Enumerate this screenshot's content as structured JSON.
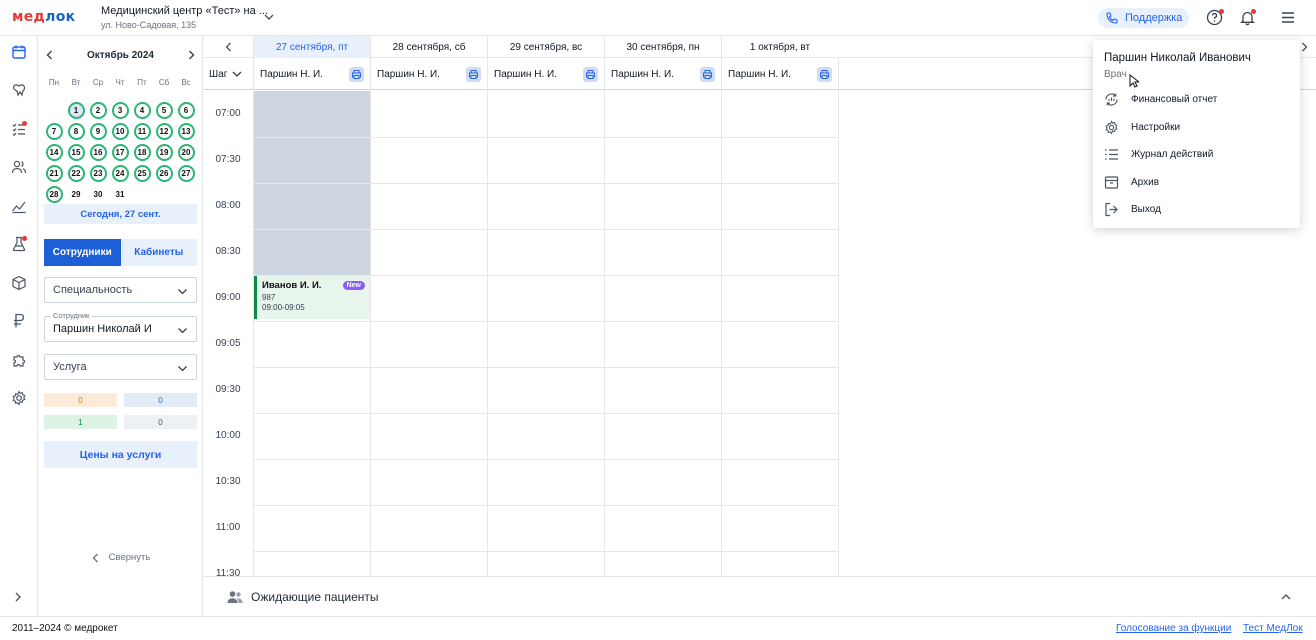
{
  "header": {
    "logo_part1": "мед",
    "logo_part2": "лок",
    "clinic_name": "Медицинский центр «Тест» на ...",
    "clinic_address": "ул. Ново-Садовая, 135",
    "support_label": "Поддержка"
  },
  "calendar": {
    "month_title": "Октябрь 2024",
    "weekdays": [
      "Пн",
      "Вт",
      "Ср",
      "Чт",
      "Пт",
      "Сб",
      "Вс"
    ],
    "days": [
      "1",
      "2",
      "3",
      "4",
      "5",
      "6",
      "7",
      "8",
      "9",
      "10",
      "11",
      "12",
      "13",
      "14",
      "15",
      "16",
      "17",
      "18",
      "19",
      "20",
      "21",
      "22",
      "23",
      "24",
      "25",
      "26",
      "27",
      "28",
      "29",
      "30",
      "31"
    ],
    "today_button": "Сегодня, 27 сент."
  },
  "filters": {
    "tab_staff": "Сотрудники",
    "tab_rooms": "Кабинеты",
    "specialty_placeholder": "Специальность",
    "employee_label": "Сотрудник",
    "employee_value": "Паршин Николай И",
    "service_placeholder": "Услуга",
    "counters": [
      "0",
      "0",
      "1",
      "0"
    ],
    "prices_button": "Цены на услуги",
    "collapse_label": "Свернуть"
  },
  "schedule": {
    "day_headers": [
      "27 сентября, пт",
      "28 сентября, сб",
      "29 сентября, вс",
      "30 сентября, пн",
      "1 октября, вт"
    ],
    "doctor_columns": [
      "Паршин Н. И.",
      "Паршин Н. И.",
      "Паршин Н. И.",
      "Паршин Н. И.",
      "Паршин Н. И."
    ],
    "step_label": "Шаг",
    "times": [
      "07:00",
      "07:30",
      "08:00",
      "08:30",
      "09:00",
      "09:05",
      "09:30",
      "10:00",
      "10:30",
      "11:00",
      "11:30"
    ],
    "appointment": {
      "patient": "Иванов И. И.",
      "badge": "New",
      "code": "987",
      "time_range": "09:00-09:05"
    }
  },
  "waiting": {
    "label": "Ожидающие пациенты"
  },
  "user_menu": {
    "name": "Паршин Николай Иванович",
    "role": "Врач",
    "items": [
      "Финансовый отчет",
      "Настройки",
      "Журнал действий",
      "Архив",
      "Выход"
    ]
  },
  "footer": {
    "copyright": "2011–2024 © медрокет",
    "link_vote": "Голосование за функции",
    "link_test": "Тест МедЛок"
  },
  "colors": {
    "accent": "#1d5fd6",
    "accent_light": "#e8f0fb",
    "day_ring": "#2bb673",
    "appointment_bar": "#0b8a4a",
    "blocked_time": "#cdd5e0",
    "badge_new": "#8b5cf6",
    "notification": "#e53935"
  }
}
